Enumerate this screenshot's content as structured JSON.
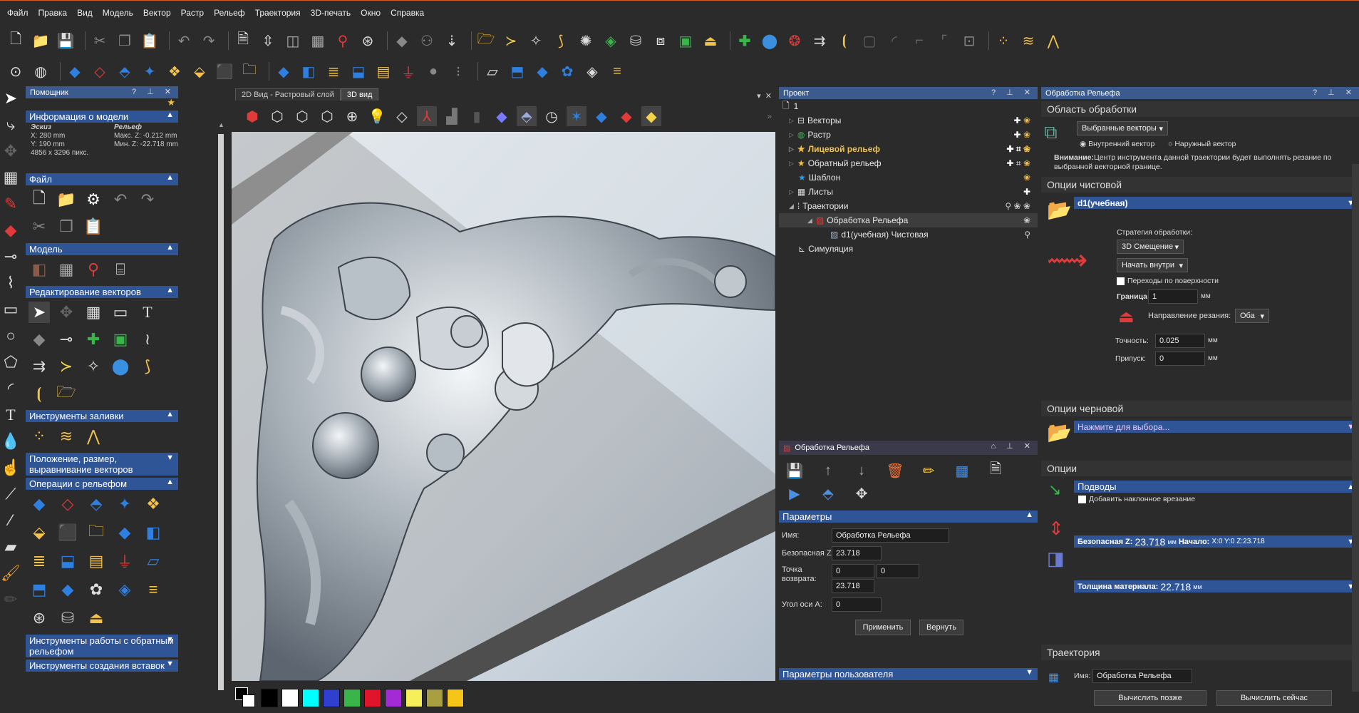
{
  "menu": [
    "Файл",
    "Правка",
    "Вид",
    "Модель",
    "Вектор",
    "Растр",
    "Рельеф",
    "Траектория",
    "3D-печать",
    "Окно",
    "Справка"
  ],
  "icons": {
    "toolbar1": [
      "new-file-icon",
      "open-folder-icon",
      "save-icon",
      "cut-icon",
      "copy-icon",
      "paste-icon",
      "undo-icon",
      "redo-icon",
      "document-icon",
      "dimension-icon",
      "mirror-icon",
      "grid-icon",
      "wand-icon",
      "measure-icon",
      "node-icon",
      "weld-icon",
      "fill-icon",
      "folder-star-icon",
      "chevron-icon",
      "sparkle-icon",
      "curve-icon",
      "star-icon",
      "relief-icon",
      "stamp-icon",
      "tile-icon",
      "merge-icon",
      "pad-icon",
      "add-icon",
      "bulb-icon",
      "circle-pattern-icon",
      "offset-icon",
      "bracket-icon",
      "box-icon",
      "fillet-icon",
      "chamfer-icon",
      "corner-icon",
      "frame-icon",
      "dots-icon",
      "wave-icon",
      "zigzag-icon"
    ],
    "toolbar2": [
      "zoom-fit-icon",
      "globe-icon",
      "diamond-blue-icon",
      "eraser-icon",
      "diamond-stack-icon",
      "spiky-icon",
      "pattern-icon",
      "yellow-diamond-icon",
      "orange-box-icon",
      "folder-sparkle-icon",
      "blue-diamond-icon",
      "split-icon",
      "layers-icon",
      "box-blue-icon",
      "striped-icon",
      "weight-icon",
      "sphere-icon",
      "drop-icon",
      "slab-icon",
      "slab2-icon",
      "cube-blue-icon",
      "flower-icon",
      "tile-white-icon",
      "stack-icon"
    ]
  },
  "helper": {
    "title": "Помощник",
    "model_info": {
      "header": "Информация о модели",
      "sketch_label": "Эскиз",
      "relief_label": "Рельеф",
      "x": "X: 280 mm",
      "y": "Y: 190 mm",
      "pix": "4856 x 3296 пикс.",
      "zmax": "Макс. Z: -0.212 mm",
      "zmin": "Мин. Z: -22.718 mm"
    },
    "sections": {
      "file": "Файл",
      "model": "Модель",
      "vector_edit": "Редактирование векторов",
      "fill_tools": "Инструменты заливки",
      "position": "Положение, размер, выравнивание векторов",
      "relief_ops": "Операции с рельефом",
      "back_relief": "Инструменты работы с обратным рельефом",
      "inserts": "Инструменты создания вставок"
    }
  },
  "tabs": [
    "2D Вид - Растровый слой",
    "3D вид"
  ],
  "project": {
    "title": "Проект",
    "root": "1",
    "items": [
      "Векторы",
      "Растр",
      "Лицевой рельеф",
      "Обратный рельеф",
      "Шаблон",
      "Листы",
      "Траектории",
      "Обработка Рельефа",
      "d1(учебная) Чистовая",
      "Симуляция"
    ]
  },
  "relief_panel": {
    "title": "Обработка Рельефа",
    "params_header": "Параметры",
    "name_label": "Имя:",
    "name_value": "Обработка Рельефа",
    "safez_label": "Безопасная Z:",
    "safez_value": "23.718",
    "return_label": "Точка возврата:",
    "rx": "0",
    "ry": "0",
    "rz": "23.718",
    "axis_label": "Угол оси А:",
    "axis_value": "0",
    "apply": "Применить",
    "revert": "Вернуть",
    "user_params": "Параметры пользователя"
  },
  "right": {
    "title": "Обработка Рельефа",
    "area": "Область обработки",
    "area_dd": "Выбранные векторы",
    "inner": "Внутренний вектор",
    "outer": "Наружный вектор",
    "warn_bold": "Внимание:",
    "warn_text": "Центр инструмента данной траектории будет выполнять резание по выбранной векторной границе.",
    "finish": "Опции чистовой",
    "tool": "d1(учебная)",
    "strategy_label": "Стратегия обработки:",
    "strategy": "3D Смещение",
    "start": "Начать внутри",
    "transitions": "Переходы по поверхности",
    "border_label": "Граница",
    "border_value": "1",
    "mm": "мм",
    "dir_label": "Направление резания:",
    "dir": "Оба",
    "accuracy_label": "Точность:",
    "accuracy": "0.025",
    "allowance_label": "Припуск:",
    "allowance": "0",
    "rough": "Опции черновой",
    "rough_pick": "Нажмите для выбора...",
    "options": "Опции",
    "leadins": "Подводы",
    "ramp": "Добавить наклонное врезание",
    "safez_bold": "Безопасная Z:",
    "safez_val": "23.718",
    "start_bold": "Начало:",
    "start_val": "X:0 Y:0 Z:23.718",
    "thick_bold": "Толщина материала:",
    "thick_val": "22.718",
    "traj": "Траектория",
    "traj_name_label": "Имя:",
    "traj_name": "Обработка Рельефа",
    "calc_later": "Вычислить позже",
    "calc_now": "Вычислить сейчас"
  },
  "palette": [
    "#000000",
    "#ffffff",
    "#00ffff",
    "#2f3fcf",
    "#3ab54a",
    "#e0142b",
    "#a32bd6",
    "#f5ef5a",
    "#a8a040",
    "#f5c518"
  ]
}
